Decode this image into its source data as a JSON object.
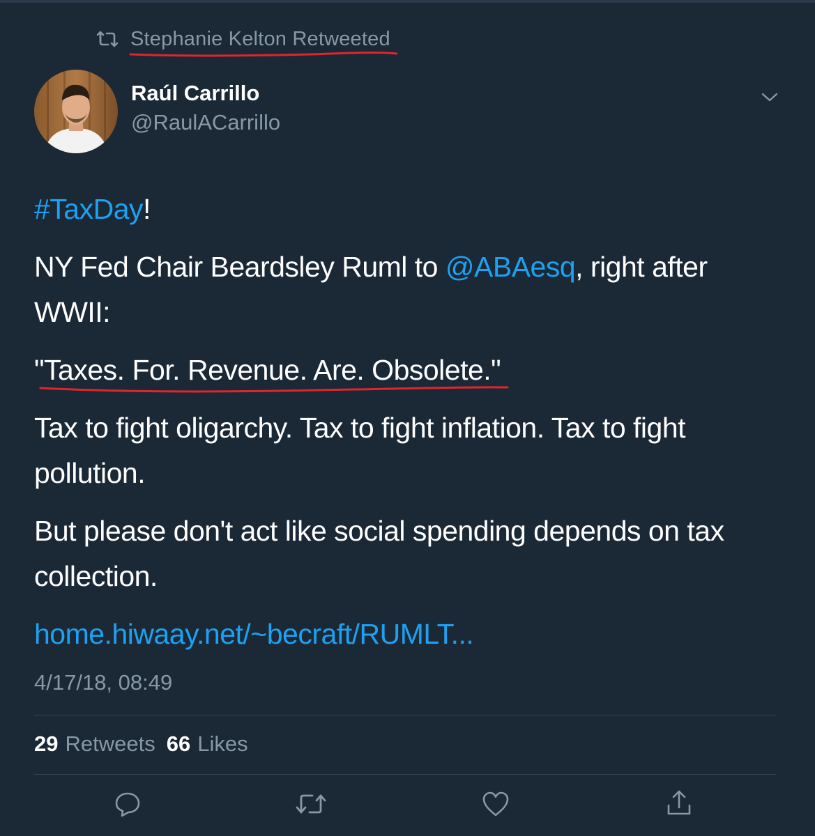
{
  "retweet_banner": {
    "icon": "retweet-icon",
    "text": "Stephanie Kelton Retweeted"
  },
  "author": {
    "name": "Raúl Carrillo",
    "handle": "@RaulACarrillo",
    "avatar_icon": "avatar-photo"
  },
  "tweet": {
    "hashtag": "#TaxDay",
    "hashtag_suffix": "!",
    "line2_before": "NY Fed Chair Beardsley Ruml to ",
    "mention": "@ABAesq",
    "line2_after": ", right after WWII:",
    "quote": "\"Taxes. For. Revenue. Are. Obsolete.\"",
    "line4": "Tax to fight oligarchy. Tax to fight inflation. Tax to fight pollution.",
    "line5": "But please don't act like social spending depends on tax collection.",
    "url": "home.hiwaay.net/~becraft/RUMLT..."
  },
  "timestamp": "4/17/18, 08:49",
  "stats": {
    "retweets_count": "29",
    "retweets_label": "Retweets",
    "likes_count": "66",
    "likes_label": "Likes"
  },
  "actions": [
    "reply-icon",
    "retweet-icon",
    "like-icon",
    "share-icon"
  ],
  "colors": {
    "background": "#1b2836",
    "link": "#1da1f2",
    "muted": "#8899a6",
    "annotation": "#e0262b"
  }
}
